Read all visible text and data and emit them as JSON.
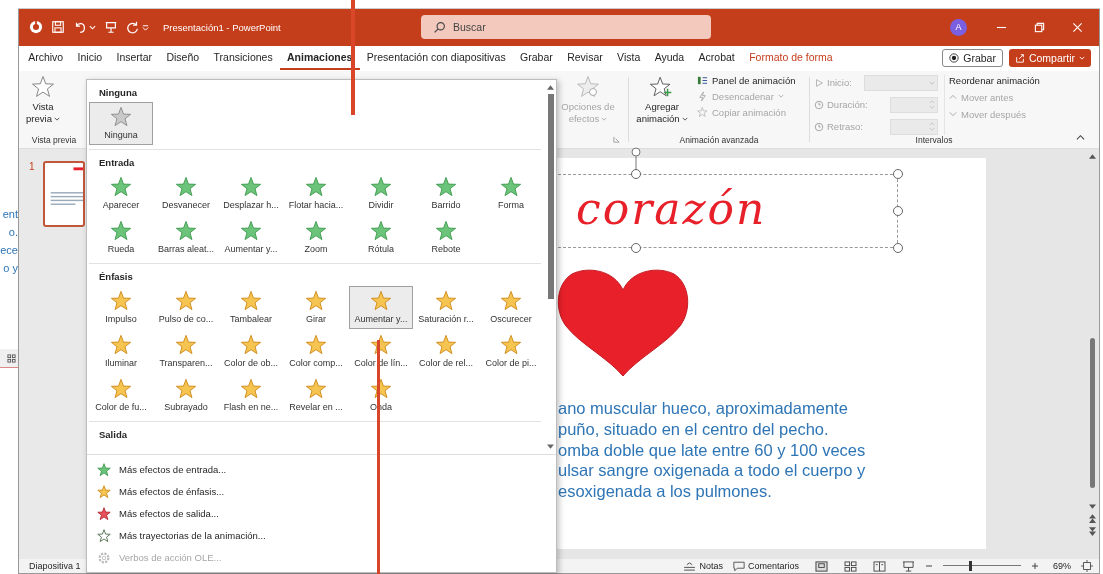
{
  "background_window": {
    "text_fragments": [
      "ent",
      "o.",
      "ece",
      "o y"
    ]
  },
  "window": {
    "title": "Presentación1 - PowerPoint",
    "search": {
      "placeholder": "Buscar"
    },
    "account_initial": "A"
  },
  "ribbon_tabs": [
    {
      "label": "Archivo",
      "selected": false,
      "kind": "normal"
    },
    {
      "label": "Inicio",
      "selected": false,
      "kind": "normal"
    },
    {
      "label": "Insertar",
      "selected": false,
      "kind": "normal"
    },
    {
      "label": "Diseño",
      "selected": false,
      "kind": "normal"
    },
    {
      "label": "Transiciones",
      "selected": false,
      "kind": "normal"
    },
    {
      "label": "Animaciones",
      "selected": true,
      "kind": "normal"
    },
    {
      "label": "Presentación con diapositivas",
      "selected": false,
      "kind": "normal"
    },
    {
      "label": "Grabar",
      "selected": false,
      "kind": "normal"
    },
    {
      "label": "Revisar",
      "selected": false,
      "kind": "normal"
    },
    {
      "label": "Vista",
      "selected": false,
      "kind": "normal"
    },
    {
      "label": "Ayuda",
      "selected": false,
      "kind": "normal"
    },
    {
      "label": "Acrobat",
      "selected": false,
      "kind": "normal"
    },
    {
      "label": "Formato de forma",
      "selected": false,
      "kind": "contextual"
    }
  ],
  "ribbon_actions": [
    {
      "label": "Grabar",
      "kind": "record"
    },
    {
      "label": "Compartir",
      "kind": "share"
    }
  ],
  "ribbon": {
    "preview": {
      "label": "Vista previa",
      "group": "Vista previa"
    },
    "effect_options": {
      "label": "Opciones de efectos",
      "disabled": true
    },
    "add_animation": {
      "label": "Agregar animación"
    },
    "advanced": [
      {
        "label": "Panel de animación",
        "disabled": false,
        "dropdown": false
      },
      {
        "label": "Desencadenar",
        "disabled": true,
        "dropdown": true
      },
      {
        "label": "Copiar animación",
        "disabled": true,
        "dropdown": false
      }
    ],
    "advanced_group": "Animación avanzada",
    "timing": [
      {
        "label": "Inicio:",
        "kind": "dropdown",
        "disabled": true
      },
      {
        "label": "Duración:",
        "kind": "spinner",
        "disabled": true
      },
      {
        "label": "Retraso:",
        "kind": "spinner",
        "disabled": true
      }
    ],
    "reorder": {
      "title": "Reordenar animación",
      "buttons": [
        {
          "label": "Mover antes",
          "kind": "up",
          "disabled": true
        },
        {
          "label": "Mover después",
          "kind": "down",
          "disabled": true
        }
      ]
    },
    "timing_group": "Intervalos"
  },
  "animation_gallery": {
    "sections": [
      {
        "title": "Ninguna",
        "kind": "none",
        "items": [
          {
            "label": "Ninguna",
            "selected": true
          }
        ]
      },
      {
        "title": "Entrada",
        "kind": "entrance",
        "items": [
          {
            "label": "Aparecer",
            "selected": false
          },
          {
            "label": "Desvanecer",
            "selected": false
          },
          {
            "label": "Desplazar h...",
            "selected": false
          },
          {
            "label": "Flotar hacia...",
            "selected": false
          },
          {
            "label": "Dividir",
            "selected": false
          },
          {
            "label": "Barrido",
            "selected": false
          },
          {
            "label": "Forma",
            "selected": false
          },
          {
            "label": "Rueda",
            "selected": false
          },
          {
            "label": "Barras aleat...",
            "selected": false
          },
          {
            "label": "Aumentar y...",
            "selected": false
          },
          {
            "label": "Zoom",
            "selected": false
          },
          {
            "label": "Rótula",
            "selected": false
          },
          {
            "label": "Rebote",
            "selected": false
          }
        ]
      },
      {
        "title": "Énfasis",
        "kind": "emphasis",
        "items": [
          {
            "label": "Impulso",
            "selected": false
          },
          {
            "label": "Pulso de co...",
            "selected": false
          },
          {
            "label": "Tambalear",
            "selected": false
          },
          {
            "label": "Girar",
            "selected": false
          },
          {
            "label": "Aumentar y...",
            "selected": true
          },
          {
            "label": "Saturación r...",
            "selected": false
          },
          {
            "label": "Oscurecer",
            "selected": false
          },
          {
            "label": "Iluminar",
            "selected": false
          },
          {
            "label": "Transparen...",
            "selected": false
          },
          {
            "label": "Color de ob...",
            "selected": false
          },
          {
            "label": "Color comp...",
            "selected": false
          },
          {
            "label": "Color de lín...",
            "selected": false
          },
          {
            "label": "Color de rel...",
            "selected": false
          },
          {
            "label": "Color de pi...",
            "selected": false
          },
          {
            "label": "Color de fu...",
            "selected": false
          },
          {
            "label": "Subrayado",
            "selected": false
          },
          {
            "label": "Flash en ne...",
            "selected": false
          },
          {
            "label": "Revelar en ...",
            "selected": false
          },
          {
            "label": "Onda",
            "selected": false
          }
        ]
      },
      {
        "title": "Salida"
      }
    ],
    "menu": [
      {
        "label": "Más efectos de entrada...",
        "kind": "entrance",
        "disabled": false
      },
      {
        "label": "Más efectos de énfasis...",
        "kind": "emphasis",
        "disabled": false
      },
      {
        "label": "Más efectos de salida...",
        "kind": "exit",
        "disabled": false
      },
      {
        "label": "Más trayectorias de la animación...",
        "kind": "path",
        "disabled": false
      },
      {
        "label": "Verbos de acción OLE...",
        "kind": "ole",
        "disabled": true
      }
    ]
  },
  "slides_pane": {
    "slides": [
      {
        "number": "1",
        "selected": true
      }
    ]
  },
  "slide": {
    "title": "corazón",
    "body_lines": [
      "ano muscular hueco, aproximadamente",
      "puño, situado en el centro del pecho.",
      "omba doble que late entre 60 y 100 veces",
      "ulsar sangre oxigenada a todo el cuerpo y",
      "esoxigenada a los pulmones."
    ]
  },
  "status_bar": {
    "slide_info": "Diapositiva 1",
    "notes": "Notas",
    "comments": "Comentarios",
    "zoom": "69%",
    "zoom_slider": {
      "level": 0.35
    }
  }
}
